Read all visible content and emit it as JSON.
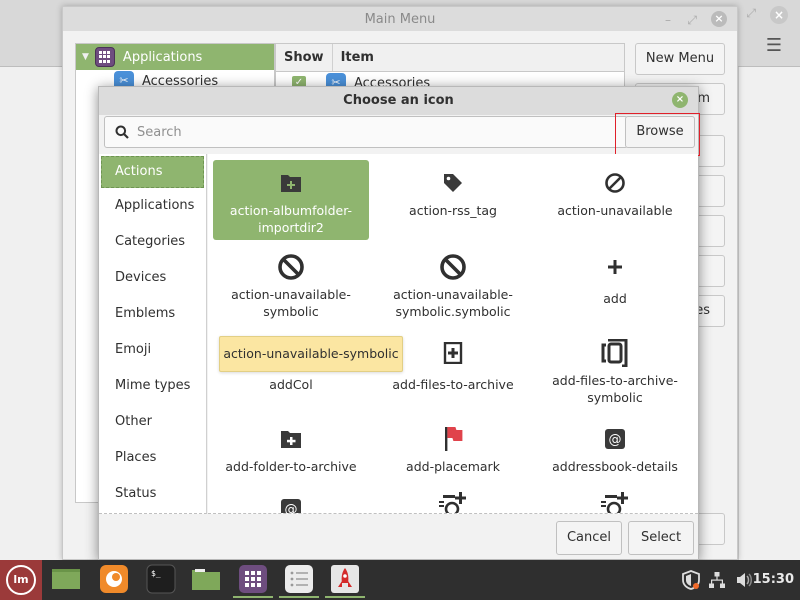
{
  "background_app": {
    "menu_icon": "hamburger-icon"
  },
  "main_window": {
    "title": "Main Menu",
    "tree": {
      "root": {
        "label": "Applications",
        "icon": "applications-grid-icon",
        "expanded": true
      },
      "children": [
        {
          "label": "Accessories",
          "icon": "accessories-icon"
        }
      ]
    },
    "list": {
      "columns": [
        "Show",
        "Item"
      ],
      "rows": [
        {
          "show": true,
          "label": "Accessories",
          "icon": "accessories-icon"
        }
      ]
    },
    "buttons": {
      "new_menu": "New Menu",
      "new_item_partial": "m",
      "properties_partial": "es"
    }
  },
  "dialog": {
    "title": "Choose an icon",
    "search": {
      "placeholder": "Search",
      "value": ""
    },
    "browse_label": "Browse",
    "categories": [
      {
        "label": "Actions",
        "selected": true
      },
      {
        "label": "Applications",
        "selected": false
      },
      {
        "label": "Categories",
        "selected": false
      },
      {
        "label": "Devices",
        "selected": false
      },
      {
        "label": "Emblems",
        "selected": false
      },
      {
        "label": "Emoji",
        "selected": false
      },
      {
        "label": "Mime types",
        "selected": false
      },
      {
        "label": "Other",
        "selected": false
      },
      {
        "label": "Places",
        "selected": false
      },
      {
        "label": "Status",
        "selected": false
      }
    ],
    "icons": [
      {
        "name": "action-albumfolder-importdir2",
        "line1": "action-albumfolder-",
        "line2": "importdir2",
        "glyph": "folder-plus-icon",
        "selected": true
      },
      {
        "name": "action-rss_tag",
        "line1": "action-rss_tag",
        "line2": "",
        "glyph": "tag-icon",
        "selected": false
      },
      {
        "name": "action-unavailable",
        "line1": "action-unavailable",
        "line2": "",
        "glyph": "unavailable-icon",
        "selected": false
      },
      {
        "name": "action-unavailable-symbolic",
        "line1": "action-unavailable-",
        "line2": "symbolic",
        "glyph": "unavailable-bold-icon",
        "selected": false
      },
      {
        "name": "action-unavailable-symbolic.symbolic",
        "line1": "action-unavailable-",
        "line2": "symbolic.symbolic",
        "glyph": "unavailable-bold-icon",
        "selected": false
      },
      {
        "name": "add",
        "line1": "add",
        "line2": "",
        "glyph": "plus-icon",
        "selected": false
      },
      {
        "name": "addCol",
        "line1": "addCol",
        "line2": "",
        "glyph": "",
        "selected": false
      },
      {
        "name": "add-files-to-archive",
        "line1": "add-files-to-archive",
        "line2": "",
        "glyph": "file-plus-icon",
        "selected": false
      },
      {
        "name": "add-files-to-archive-symbolic",
        "line1": "add-files-to-archive-",
        "line2": "symbolic",
        "glyph": "archive-icon",
        "selected": false
      },
      {
        "name": "add-folder-to-archive",
        "line1": "add-folder-to-archive",
        "line2": "",
        "glyph": "folder-plus-icon",
        "selected": false
      },
      {
        "name": "add-placemark",
        "line1": "add-placemark",
        "line2": "",
        "glyph": "flag-icon",
        "selected": false
      },
      {
        "name": "addressbook-details",
        "line1": "addressbook-details",
        "line2": "",
        "glyph": "at-sign-icon",
        "selected": false
      },
      {
        "name": "",
        "line1": "",
        "line2": "",
        "glyph": "at-sign-icon",
        "selected": false
      },
      {
        "name": "",
        "line1": "",
        "line2": "",
        "glyph": "contact-add-icon",
        "selected": false
      },
      {
        "name": "",
        "line1": "",
        "line2": "",
        "glyph": "contact-add-icon",
        "selected": false
      }
    ],
    "tooltip": "action-unavailable-symbolic",
    "cancel_label": "Cancel",
    "select_label": "Select"
  },
  "taskbar": {
    "menu_icon": "linux-mint-logo-icon",
    "apps": [
      {
        "name": "show-desktop",
        "icon": "desktop-icon"
      },
      {
        "name": "firefox",
        "icon": "firefox-icon"
      },
      {
        "name": "terminal",
        "icon": "terminal-icon",
        "text": "$_"
      },
      {
        "name": "files",
        "icon": "folder-icon"
      },
      {
        "name": "main-menu-editor",
        "icon": "applications-grid-icon",
        "active": true
      },
      {
        "name": "text-editor",
        "icon": "list-icon",
        "active": true
      },
      {
        "name": "rocket-app",
        "icon": "rocket-icon",
        "active": true
      }
    ],
    "tray": [
      "shield-update-icon",
      "network-icon",
      "volume-icon"
    ],
    "clock": "15:30",
    "colors": {
      "accent": "#8fb56f",
      "menu_bg": "#9b3a3a"
    }
  }
}
